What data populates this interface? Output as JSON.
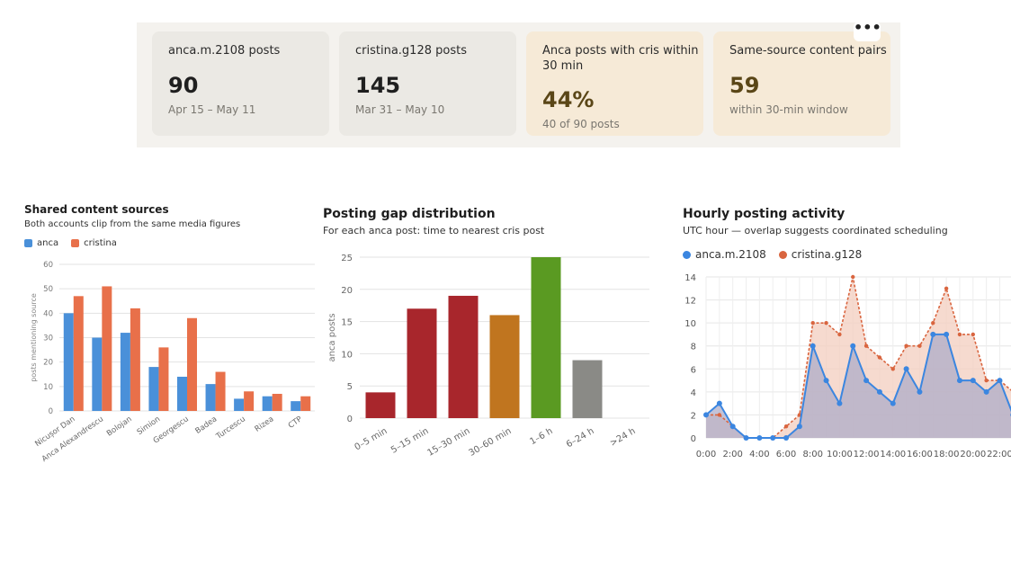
{
  "stats": [
    {
      "label": "anca.m.2108 posts",
      "value": "90",
      "sub": "Apr 15 – May 11",
      "accent": false
    },
    {
      "label": "cristina.g128 posts",
      "value": "145",
      "sub": "Mar 31 – May 10",
      "accent": false
    },
    {
      "label": "Anca posts with cris within 30 min",
      "value": "44%",
      "sub": "40 of 90 posts",
      "accent": true
    },
    {
      "label": "Same-source content pairs",
      "value": "59",
      "sub": "within 30-min window",
      "accent": true
    }
  ],
  "more_button": "•••",
  "colors": {
    "anca": "#4a90d9",
    "cristina": "#e8704a",
    "anca_line": "#3b86e0",
    "cristina_line": "#d9653f"
  },
  "chart_data": [
    {
      "type": "bar",
      "title": "Shared content sources",
      "subtitle": "Both accounts clip from the same media figures",
      "ylabel": "posts mentioning source",
      "ylim": [
        0,
        60
      ],
      "yticks": [
        0,
        10,
        20,
        30,
        40,
        50,
        60
      ],
      "categories": [
        "Nicușor Dan",
        "Anca Alexandrescu",
        "Bolojan",
        "Simion",
        "Georgescu",
        "Badea",
        "Turcescu",
        "Rizea",
        "CTP"
      ],
      "series": [
        {
          "name": "anca",
          "values": [
            40,
            30,
            32,
            18,
            14,
            11,
            5,
            6,
            4
          ]
        },
        {
          "name": "cristina",
          "values": [
            47,
            51,
            42,
            26,
            38,
            16,
            8,
            7,
            6
          ]
        }
      ],
      "legend": "top-left"
    },
    {
      "type": "bar",
      "title": "Posting gap distribution",
      "subtitle": "For each anca post: time to nearest cris post",
      "ylabel": "anca posts",
      "ylim": [
        0,
        25
      ],
      "yticks": [
        0,
        5,
        10,
        15,
        20,
        25
      ],
      "categories": [
        "0–5 min",
        "5–15 min",
        "15–30 min",
        "30–60 min",
        "1–6 h",
        "6–24 h",
        ">24 h"
      ],
      "values": [
        4,
        17,
        19,
        16,
        25,
        9,
        0
      ],
      "bar_colors": [
        "#a8262c",
        "#a8262c",
        "#a8262c",
        "#c0751f",
        "#5a9a22",
        "#8a8a86",
        "#8a8a86"
      ]
    },
    {
      "type": "line",
      "title": "Hourly posting activity",
      "subtitle": "UTC hour — overlap suggests coordinated scheduling",
      "ylim": [
        0,
        14
      ],
      "yticks": [
        0,
        2,
        4,
        6,
        8,
        10,
        12,
        14
      ],
      "xticks": [
        "0:00",
        "2:00",
        "4:00",
        "6:00",
        "8:00",
        "10:00",
        "12:00",
        "14:00",
        "16:00",
        "18:00",
        "20:00",
        "22:00"
      ],
      "x": [
        0,
        1,
        2,
        3,
        4,
        5,
        6,
        7,
        8,
        9,
        10,
        11,
        12,
        13,
        14,
        15,
        16,
        17,
        18,
        19,
        20,
        21,
        22,
        23
      ],
      "series": [
        {
          "name": "anca.m.2108",
          "values": [
            2,
            3,
            1,
            0,
            0,
            0,
            0,
            1,
            8,
            5,
            3,
            8,
            5,
            4,
            3,
            6,
            4,
            9,
            9,
            5,
            5,
            4,
            5,
            2
          ]
        },
        {
          "name": "cristina.g128",
          "values": [
            2,
            2,
            1,
            0,
            0,
            0,
            1,
            2,
            10,
            10,
            9,
            14,
            8,
            7,
            6,
            8,
            8,
            10,
            13,
            9,
            9,
            5,
            5,
            4
          ]
        }
      ],
      "legend": "top-left",
      "grid": true
    }
  ]
}
